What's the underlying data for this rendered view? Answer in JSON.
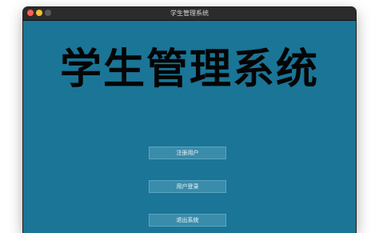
{
  "window": {
    "title": "学生管理系统"
  },
  "main": {
    "banner": "学生管理系统",
    "buttons": {
      "register": "注册用户",
      "login": "用户登录",
      "exit": "退出系统"
    }
  },
  "colors": {
    "background": "#1a7597",
    "button": "#3a8cab",
    "titlebar": "#2b2b2b"
  }
}
